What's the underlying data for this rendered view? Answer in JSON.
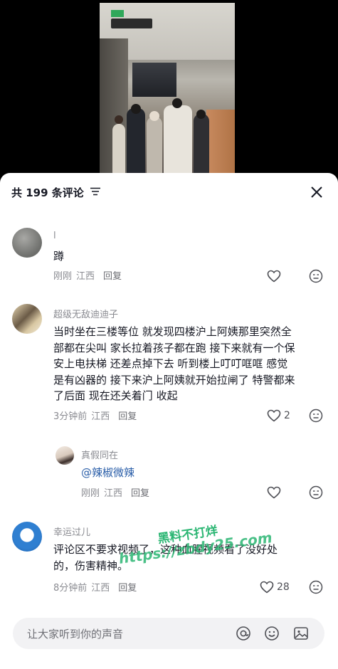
{
  "header": {
    "title": "共 199 条评论"
  },
  "comments": [
    {
      "username": "l",
      "text": "蹲",
      "time": "刚刚",
      "location": "江西",
      "reply_label": "回复",
      "likes": ""
    },
    {
      "username": "超级无敌迪迪子",
      "text_lines": [
        "当时坐在三楼等位 就发现四楼沪上阿姨那里突然全",
        "部都在尖叫 家长拉着孩子都在跑 接下来就有一个保",
        "安上电扶梯 还差点掉下去 听到楼上叮叮哐哐 感觉",
        "是有凶器的 接下来沪上阿姨就开始拉闸了 特警都来",
        "了后面 现在还关着门"
      ],
      "collapse_label": "收起",
      "time": "3分钟前",
      "location": "江西",
      "reply_label": "回复",
      "likes": "2",
      "replies": [
        {
          "username": "真假同在",
          "text": "@辣椒微辣",
          "time": "刚刚",
          "location": "江西",
          "reply_label": "回复"
        }
      ]
    },
    {
      "username": "幸运过儿",
      "text_lines": [
        "评论区不要求视频了，这种血腥视频看了没好处",
        "的，伤害精神。"
      ],
      "time": "8分钟前",
      "location": "江西",
      "reply_label": "回复",
      "likes": "28"
    }
  ],
  "input": {
    "placeholder": "让大家听到你的声音"
  },
  "watermark": {
    "line1": "黑料不打烊",
    "line2": "https://zbdy25.com"
  },
  "colors": {
    "sheet_bg": "#ffffff",
    "text_primary": "#161823",
    "text_secondary": "#8a8b91",
    "mention": "#2a5ea8",
    "watermark": "#2bb673"
  }
}
